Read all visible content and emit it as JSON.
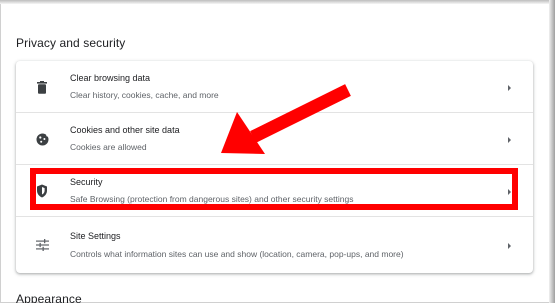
{
  "section": {
    "title": "Privacy and security",
    "next_title": "Appearance"
  },
  "items": [
    {
      "icon": "trash-icon",
      "title": "Clear browsing data",
      "subtitle": "Clear history, cookies, cache, and more"
    },
    {
      "icon": "cookie-icon",
      "title": "Cookies and other site data",
      "subtitle": "Cookies are allowed"
    },
    {
      "icon": "shield-icon",
      "title": "Security",
      "subtitle": "Safe Browsing (protection from dangerous sites) and other security settings"
    },
    {
      "icon": "sliders-icon",
      "title": "Site Settings",
      "subtitle": "Controls what information sites can use and show (location, camera, pop-ups, and more)"
    }
  ],
  "colors": {
    "annotation": "#ff0000",
    "icon": "#5f6368",
    "text_primary": "#202124",
    "text_secondary": "#5f6368"
  }
}
